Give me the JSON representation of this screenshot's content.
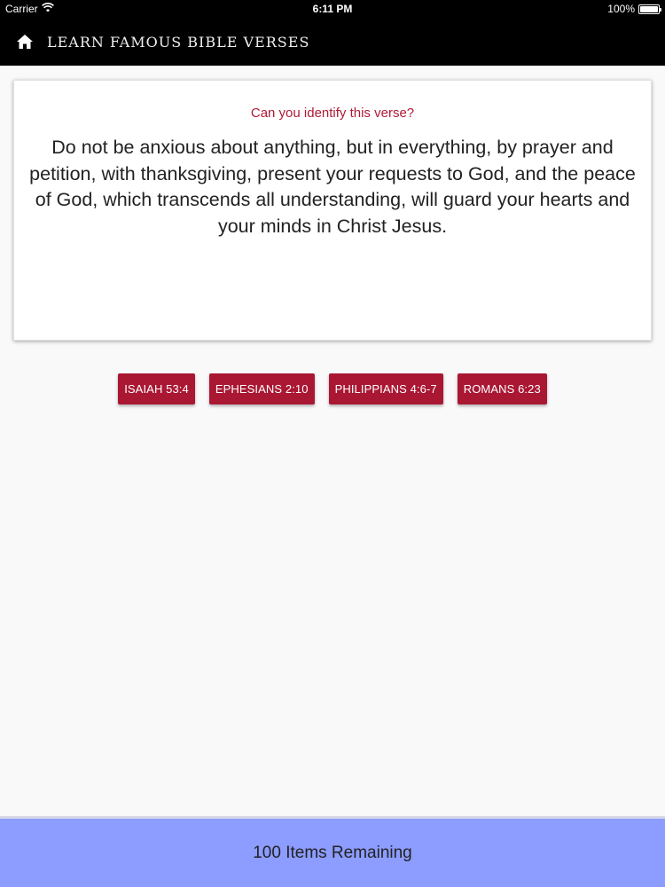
{
  "status_bar": {
    "carrier": "Carrier",
    "time": "6:11 PM",
    "battery_percent": "100%",
    "battery_level": 1.0
  },
  "nav": {
    "title": "LEARN FAMOUS BIBLE VERSES",
    "home_icon": "home-icon"
  },
  "quiz": {
    "question": "Can you identify this verse?",
    "verse": "Do not be anxious about anything, but in everything, by prayer and petition, with thanksgiving, present your requests to God, and the peace of God, which transcends all understanding, will guard your hearts and your minds in Christ Jesus.",
    "answers": [
      "ISAIAH 53:4",
      "EPHESIANS 2:10",
      "PHILIPPIANS 4:6-7",
      "ROMANS 6:23"
    ]
  },
  "footer": {
    "remaining": "100 Items Remaining"
  },
  "colors": {
    "accent": "#aa1733",
    "question_text": "#b01a36",
    "footer_bg": "#8c9cff",
    "nav_bg": "#000000"
  }
}
